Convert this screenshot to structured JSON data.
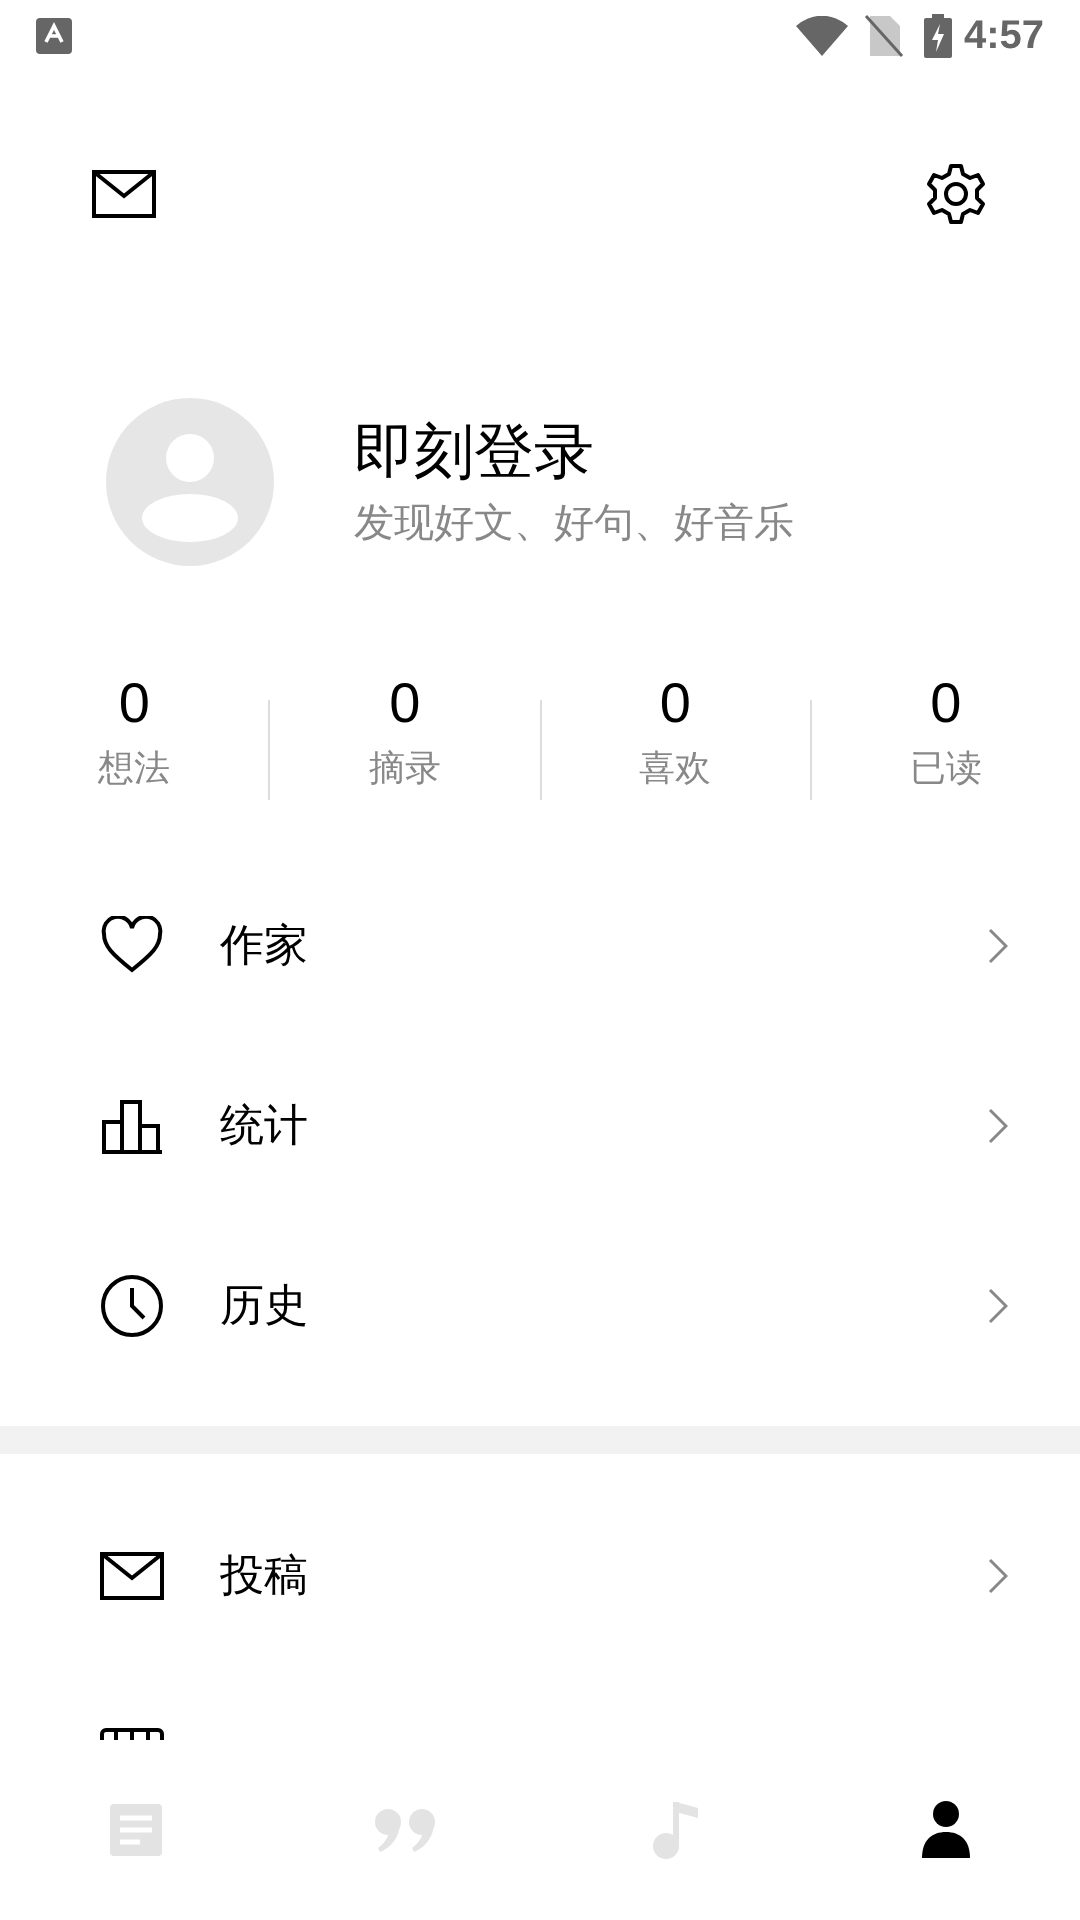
{
  "status_bar": {
    "time": "4:57"
  },
  "profile": {
    "name": "即刻登录",
    "tagline": "发现好文、好句、好音乐"
  },
  "stats": [
    {
      "value": "0",
      "label": "想法"
    },
    {
      "value": "0",
      "label": "摘录"
    },
    {
      "value": "0",
      "label": "喜欢"
    },
    {
      "value": "0",
      "label": "已读"
    }
  ],
  "menu": [
    {
      "kind": "heart",
      "label": "作家"
    },
    {
      "kind": "chart",
      "label": "统计"
    },
    {
      "kind": "clock",
      "label": "历史"
    }
  ],
  "menu_2": [
    {
      "kind": "mail",
      "label": "投稿"
    },
    {
      "kind": "piano"
    }
  ],
  "tabs": [
    {
      "kind": "article",
      "selected": false
    },
    {
      "kind": "quote",
      "selected": false
    },
    {
      "kind": "music",
      "selected": false
    },
    {
      "kind": "person",
      "selected": true
    }
  ]
}
